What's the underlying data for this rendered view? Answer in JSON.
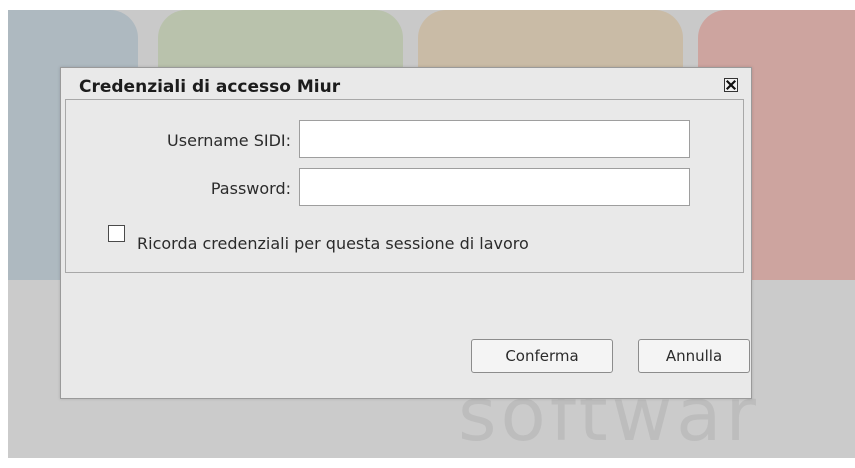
{
  "background": {
    "word": "softwar"
  },
  "dialog": {
    "title": "Credenziali di accesso Miur",
    "close_icon": "close-icon",
    "fields": {
      "username_label": "Username SIDI:",
      "username_value": "",
      "password_label": "Password:",
      "password_value": ""
    },
    "remember": {
      "label": "Ricorda credenziali per questa sessione di lavoro",
      "checked": false
    },
    "buttons": {
      "confirm": "Conferma",
      "cancel": "Annulla"
    }
  }
}
